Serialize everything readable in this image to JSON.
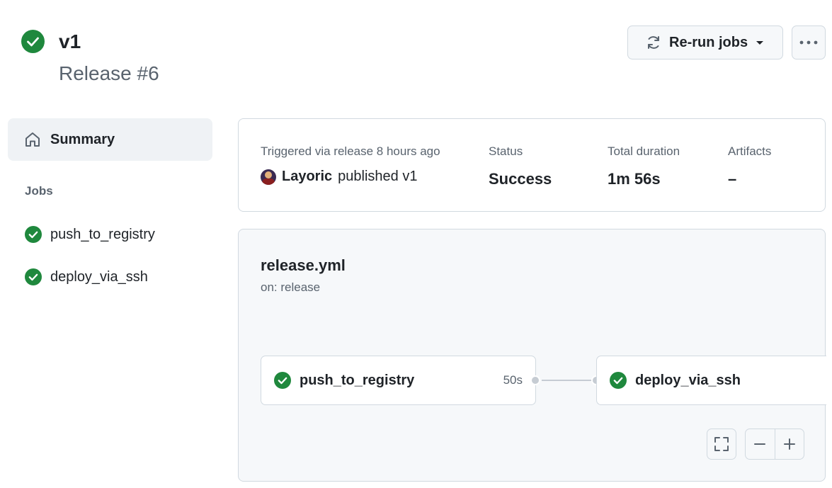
{
  "header": {
    "title": "v1",
    "subtitle": "Release #6",
    "status_icon": "check-circle-fill-icon",
    "rerun_label": "Re-run jobs",
    "more_icon": "kebab-horizontal-icon"
  },
  "sidebar": {
    "summary_label": "Summary",
    "jobs_heading": "Jobs",
    "jobs": [
      {
        "label": "push_to_registry",
        "status": "success"
      },
      {
        "label": "deploy_via_ssh",
        "status": "success"
      }
    ]
  },
  "summary": {
    "trigger_text": "Triggered via release 8 hours ago",
    "actor": "Layoric",
    "action": "published v1",
    "status_label": "Status",
    "status_value": "Success",
    "duration_label": "Total duration",
    "duration_value": "1m 56s",
    "artifacts_label": "Artifacts",
    "artifacts_value": "–"
  },
  "workflow": {
    "name": "release.yml",
    "trigger": "on: release",
    "jobs": [
      {
        "label": "push_to_registry",
        "duration": "50s",
        "status": "success"
      },
      {
        "label": "deploy_via_ssh",
        "status": "success"
      }
    ]
  },
  "colors": {
    "success": "#1f883d",
    "border": "#d1d9e0",
    "muted_text": "#59636e",
    "canvas_bg": "#f6f8fa"
  }
}
